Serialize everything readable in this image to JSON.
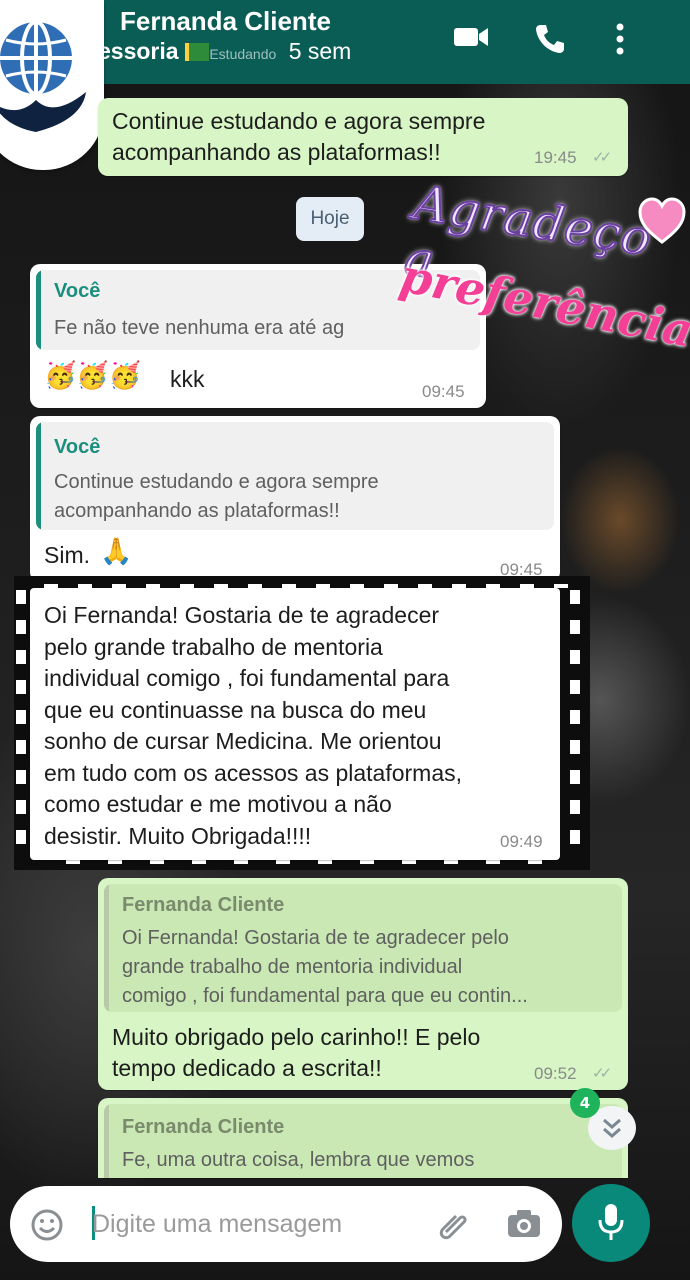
{
  "header": {
    "contact_name": "Fernanda Cliente",
    "status_bold": "essoria",
    "status_mid": "Estudando",
    "status_time": "5 sem",
    "bg_color": "#0a5d55"
  },
  "day_divider": "Hoje",
  "sticker": {
    "line1": "Agradeço a",
    "line2": "preferência!",
    "heart_color": "#f58bc0"
  },
  "messages": [
    {
      "text": "Continue estudando e agora sempre\nacompanhando as plataformas!!",
      "time": "19:45",
      "status": "read"
    },
    {
      "quote_name": "Você",
      "quote_text": "Fe não teve nenhuma era até ag",
      "text": "kkk",
      "emoji": "🥳🥳🥳",
      "time": "09:45"
    },
    {
      "quote_name": "Você",
      "quote_text": "Continue estudando e agora sempre\nacompanhando as plataformas!!",
      "text": "Sim.",
      "emoji": "🙏",
      "time": "09:45"
    },
    {
      "text": "Oi Fernanda! Gostaria de te agradecer\npelo grande trabalho de mentoria\nindividual comigo , foi fundamental para\nque eu continuasse na busca do meu\nsonho de cursar Medicina.  Me orientou\nem tudo com os acessos as plataformas,\ncomo estudar e me motivou a não\ndesistir.  Muito Obrigada!!!!",
      "time": "09:49"
    },
    {
      "quote_name": "Fernanda Cliente",
      "quote_text": "Oi Fernanda! Gostaria de te agradecer pelo\ngrande trabalho de mentoria individual\ncomigo , foi fundamental para que eu contin...",
      "text": "Muito obrigado pelo carinho!! E pelo\ntempo dedicado a escrita!!",
      "time": "09:52"
    },
    {
      "quote_name": "Fernanda Cliente",
      "quote_text": "Fe,  uma outra coisa, lembra que vemos"
    }
  ],
  "unread_count": "4",
  "composer": {
    "placeholder": "Digite uma mensagem"
  },
  "colors": {
    "outgoing": "#d8f5c5",
    "incoming": "#ffffff",
    "accent": "#09897a",
    "quote_you": "#1a8f7e"
  }
}
